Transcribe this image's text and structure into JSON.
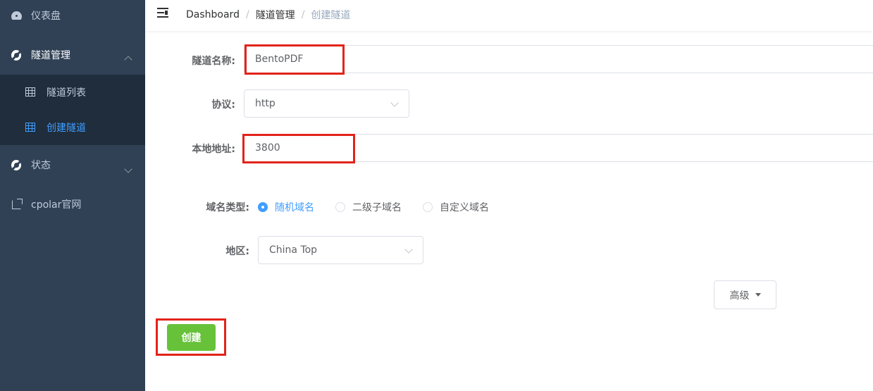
{
  "sidebar": {
    "items": [
      {
        "label": "仪表盘",
        "icon": "dashboard-gauge-icon"
      },
      {
        "label": "隧道管理",
        "icon": "tunnel-icon",
        "expanded": true
      },
      {
        "label": "状态",
        "icon": "status-icon",
        "expanded": false
      },
      {
        "label": "cpolar官网",
        "icon": "external-link-icon"
      }
    ],
    "subitems": [
      {
        "label": "隧道列表",
        "icon": "table-grid-icon"
      },
      {
        "label": "创建隧道",
        "icon": "table-grid-icon",
        "active": true
      }
    ]
  },
  "header": {
    "menu_icon": "hamburger-fold-icon",
    "breadcrumb": [
      "Dashboard",
      "隧道管理",
      "创建隧道"
    ],
    "separator": "/"
  },
  "form": {
    "name": {
      "label": "隧道名称:",
      "value": "BentoPDF"
    },
    "protocol": {
      "label": "协议:",
      "value": "http"
    },
    "local_addr": {
      "label": "本地地址:",
      "value": "3800"
    },
    "domain_type": {
      "label": "域名类型:",
      "options": [
        "随机域名",
        "二级子域名",
        "自定义域名"
      ],
      "selected": "随机域名"
    },
    "region": {
      "label": "地区:",
      "value": "China Top"
    },
    "advanced_label": "高级",
    "create_label": "创建"
  },
  "colors": {
    "sidebar_bg": "#304156",
    "submenu_bg": "#1f2d3d",
    "active": "#409eff",
    "create_button": "#67c23a",
    "highlight": "#e2231a"
  }
}
